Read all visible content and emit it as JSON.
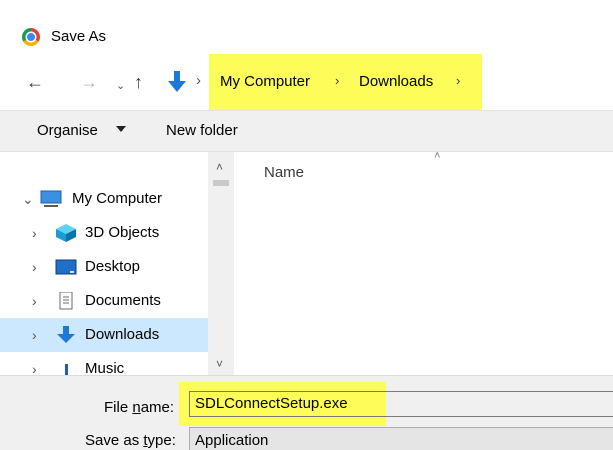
{
  "window": {
    "title": "Save As",
    "icon": "chrome-icon"
  },
  "navigation": {
    "back_icon": "back-arrow-icon",
    "forward_icon": "forward-arrow-icon",
    "recent_icon": "chevron-down-icon",
    "up_icon": "up-arrow-icon",
    "location_icon": "downloads-icon",
    "breadcrumb": [
      "My Computer",
      "Downloads"
    ],
    "highlight_color": "#fdfd5a"
  },
  "toolbar": {
    "organise_label": "Organise",
    "new_folder_label": "New folder"
  },
  "tree": {
    "items": [
      {
        "label": "My Computer",
        "icon": "computer-icon",
        "expanded": true
      },
      {
        "label": "3D Objects",
        "icon": "cube-icon"
      },
      {
        "label": "Desktop",
        "icon": "desktop-icon"
      },
      {
        "label": "Documents",
        "icon": "document-icon"
      },
      {
        "label": "Downloads",
        "icon": "downloads-icon",
        "selected": true
      },
      {
        "label": "Music",
        "icon": "music-icon"
      }
    ],
    "selected_color": "#cce8ff"
  },
  "file_list": {
    "column_name": "Name"
  },
  "form": {
    "file_name_label": "File name:",
    "file_name_value": "SDLConnectSetup.exe",
    "save_as_type_label": "Save as type:",
    "save_as_type_value": "Application"
  }
}
